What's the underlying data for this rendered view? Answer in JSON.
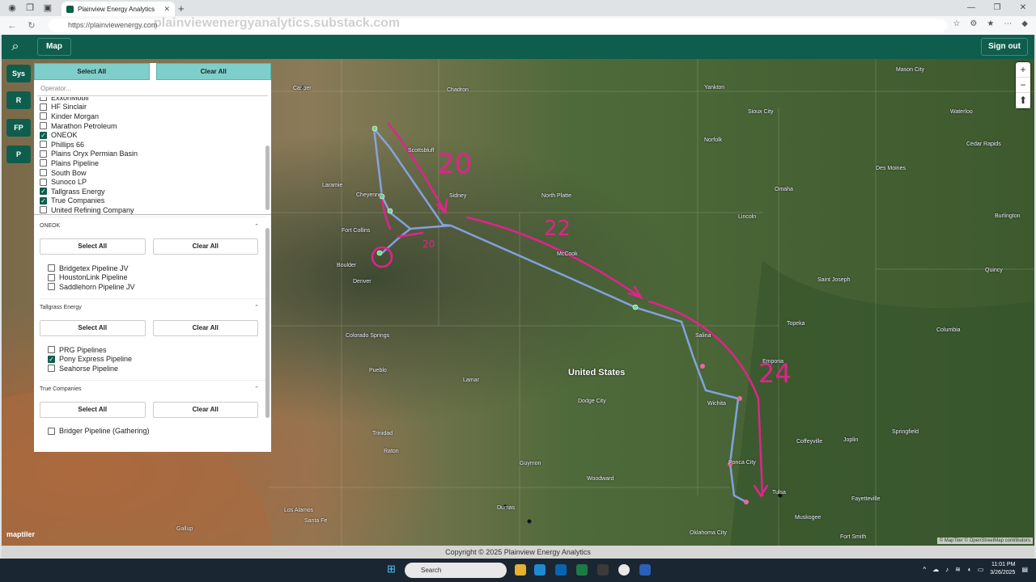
{
  "browser": {
    "tab_title": "Plainview Energy Analytics",
    "url": "https://plainviewenergy.com",
    "watermark": "plainviewenergyanalytics.substack.com"
  },
  "app": {
    "nav_map": "Map",
    "sign_out": "Sign out",
    "side_buttons": [
      "Sys",
      "R",
      "FP",
      "P"
    ]
  },
  "filters": {
    "select_all": "Select All",
    "clear_all": "Clear All",
    "operator_placeholder": "Operator...",
    "operators": [
      {
        "label": "ExxonMobil",
        "checked": false
      },
      {
        "label": "HF Sinclair",
        "checked": false
      },
      {
        "label": "Kinder Morgan",
        "checked": false
      },
      {
        "label": "Marathon Petroleum",
        "checked": false
      },
      {
        "label": "ONEOK",
        "checked": true
      },
      {
        "label": "Phillips 66",
        "checked": false
      },
      {
        "label": "Plains Oryx Permian Basin",
        "checked": false
      },
      {
        "label": "Plains Pipeline",
        "checked": false
      },
      {
        "label": "South Bow",
        "checked": false
      },
      {
        "label": "Sunoco LP",
        "checked": false
      },
      {
        "label": "Tallgrass Energy",
        "checked": true
      },
      {
        "label": "True Companies",
        "checked": true
      },
      {
        "label": "United Refining Company",
        "checked": false
      }
    ],
    "groups": [
      {
        "title": "ONEOK",
        "items": [
          {
            "label": "Bridgetex Pipeline JV",
            "checked": false
          },
          {
            "label": "HoustonLink Pipeline",
            "checked": false
          },
          {
            "label": "Saddlehorn Pipeline JV",
            "checked": false
          }
        ]
      },
      {
        "title": "Tallgrass Energy",
        "items": [
          {
            "label": "PRG Pipelines",
            "checked": false
          },
          {
            "label": "Pony Express Pipeline",
            "checked": true
          },
          {
            "label": "Seahorse Pipeline",
            "checked": false
          }
        ]
      },
      {
        "title": "True Companies",
        "items": [
          {
            "label": "Bridger Pipeline (Gathering)",
            "checked": false
          }
        ]
      }
    ]
  },
  "map": {
    "country_label": "United States",
    "places": [
      "Yankton",
      "Sioux City",
      "Norfolk",
      "Omaha",
      "Lincoln",
      "Des Moines",
      "Waterloo",
      "Cedar Rapids",
      "Mason City",
      "Burlington",
      "Quincy",
      "Saint Joseph",
      "Columbia",
      "Topeka",
      "Emporia",
      "Salina",
      "Wichita",
      "Dodge City",
      "Lamar",
      "Pueblo",
      "Colorado Springs",
      "Denver",
      "Boulder",
      "Fort Collins",
      "Cheyenne",
      "Laramie",
      "Scottsbluff",
      "Sidney",
      "North Platte",
      "McCook",
      "Chadron",
      "Casper",
      "Trinidad",
      "Raton",
      "Los Alamos",
      "Santa Fe",
      "Gallup",
      "Woodward",
      "Oklahoma City",
      "Tulsa",
      "Muskogee",
      "Joplin",
      "Springfield",
      "Fayetteville",
      "Fort Smith",
      "Ponca City",
      "Coffeyville",
      "Guymon",
      "Dumas"
    ],
    "annotations": [
      "20",
      "22",
      "24",
      "20"
    ],
    "attribution": "© MapTiler © OpenStreetMap contributors",
    "maptiler_logo": "maptiler"
  },
  "footer": "Copyright © 2025 Plainview Energy Analytics",
  "taskbar": {
    "search": "Search",
    "time": "11:01 PM",
    "date": "3/26/2025"
  }
}
